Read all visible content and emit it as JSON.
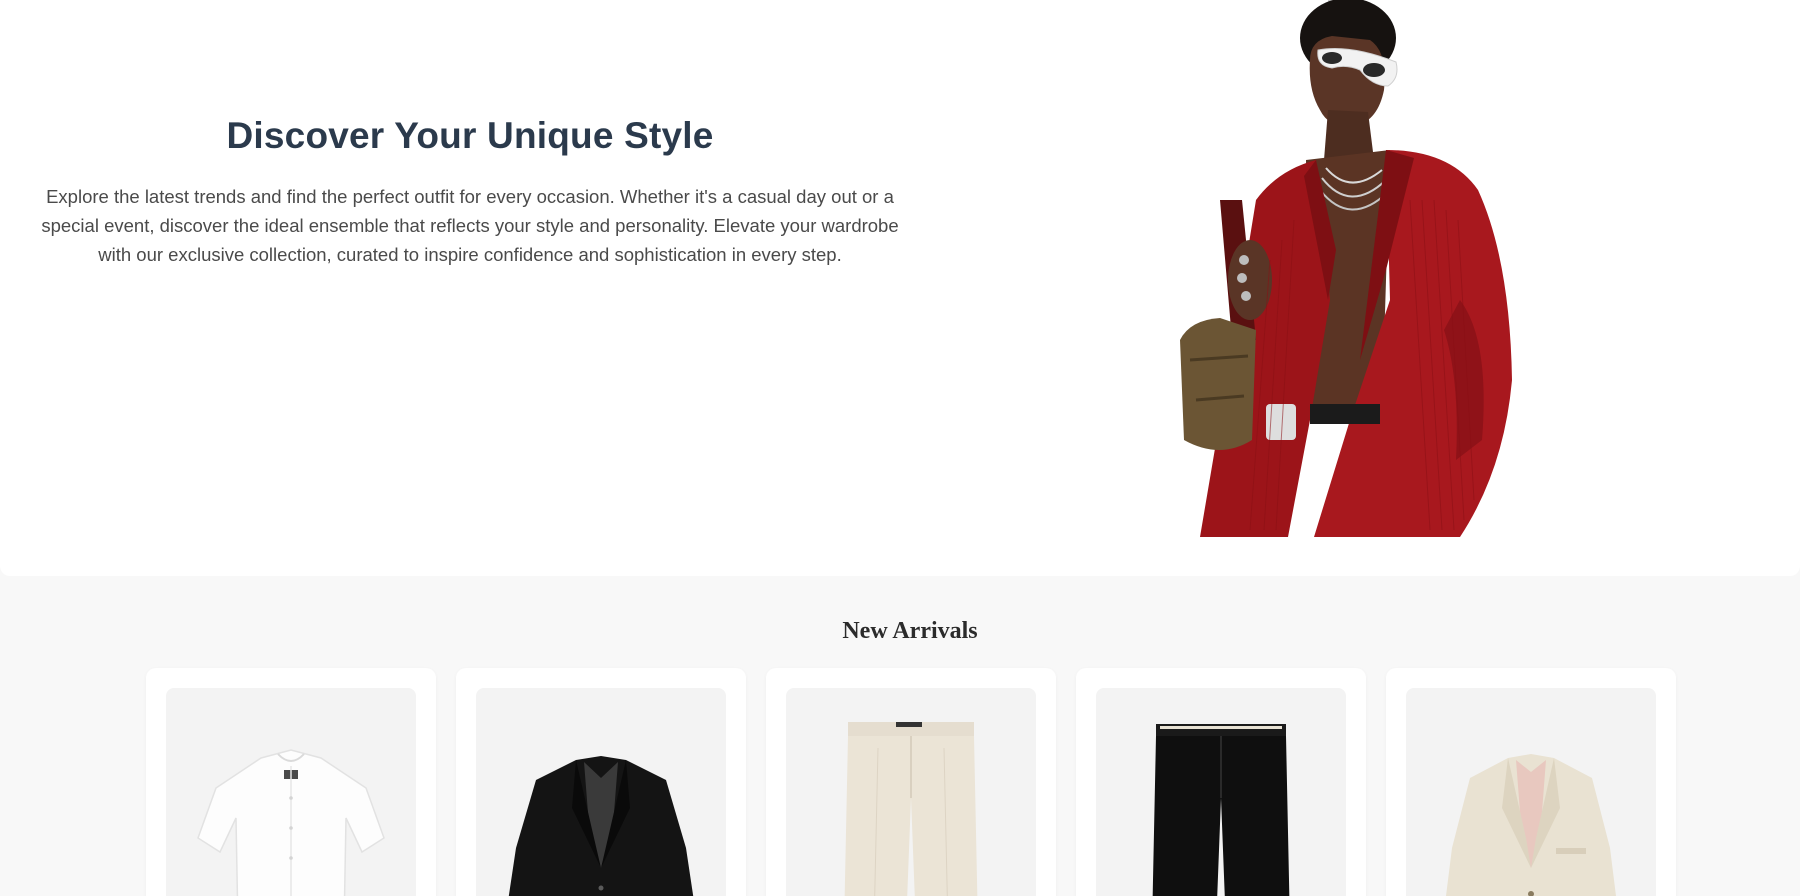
{
  "hero": {
    "title": "Discover Your Unique Style",
    "description": "Explore the latest trends and find the perfect outfit for every occasion. Whether it's a casual day out or a special event, discover the ideal ensemble that reflects your style and personality. Elevate your wardrobe with our exclusive collection, curated to inspire confidence and sophistication in every step.",
    "image": "model-red-blazer-image"
  },
  "arrivals": {
    "title": "New Arrivals",
    "products": [
      {
        "image": "white-shirt-image"
      },
      {
        "image": "black-blazer-image"
      },
      {
        "image": "beige-trousers-image"
      },
      {
        "image": "black-trousers-image"
      },
      {
        "image": "beige-blazer-image"
      }
    ]
  },
  "colors": {
    "hero_bg": "#ffffff",
    "page_bg": "#f8f8f8",
    "title": "#2b3a4c",
    "body_text": "#4a4a4a",
    "card_bg": "#ffffff",
    "image_bg": "#f3f3f3",
    "blazer_red": "#a5161c"
  }
}
